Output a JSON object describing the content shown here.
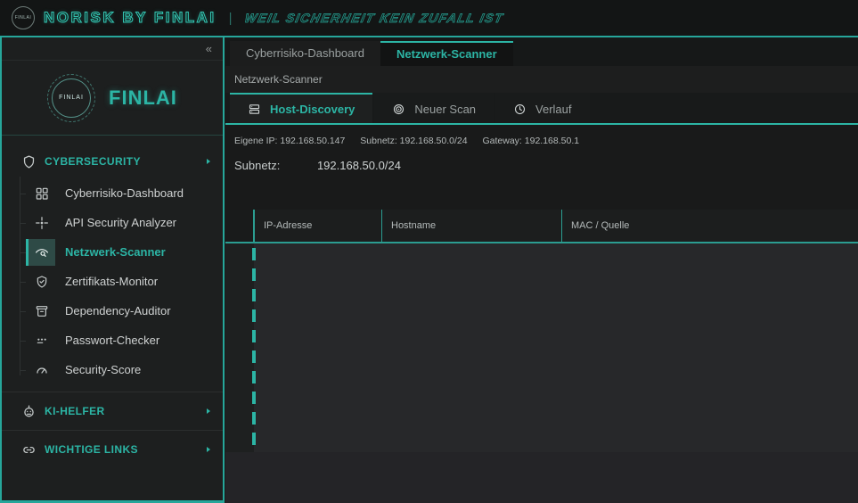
{
  "header": {
    "logo_text": "FINLAI",
    "brand": "NORISK BY FINLAI",
    "separator": "|",
    "tagline": "WEIL SICHERHEIT KEIN ZUFALL IST"
  },
  "sidebar": {
    "collapse_icon": "«",
    "logo": {
      "badge_text": "FINLAI",
      "wordmark": "FINLAI"
    },
    "section_cybersecurity": {
      "label": "CYBERSECURITY"
    },
    "menu": [
      {
        "label": "Cyberrisiko-Dashboard",
        "icon": "dashboard-icon",
        "active": false
      },
      {
        "label": "API Security Analyzer",
        "icon": "crosshair-icon",
        "active": false
      },
      {
        "label": "Netzwerk-Scanner",
        "icon": "network-scan-icon",
        "active": true
      },
      {
        "label": "Zertifikats-Monitor",
        "icon": "shield-check-icon",
        "active": false
      },
      {
        "label": "Dependency-Auditor",
        "icon": "archive-icon",
        "active": false
      },
      {
        "label": "Passwort-Checker",
        "icon": "password-icon",
        "active": false
      },
      {
        "label": "Security-Score",
        "icon": "gauge-icon",
        "active": false
      }
    ],
    "section_ki_helfer": {
      "label": "KI-HELFER"
    },
    "section_wichtige_links": {
      "label": "WICHTIGE LINKS"
    }
  },
  "main": {
    "tabs": [
      {
        "label": "Cyberrisiko-Dashboard",
        "active": false
      },
      {
        "label": "Netzwerk-Scanner",
        "active": true
      }
    ],
    "breadcrumb": "Netzwerk-Scanner",
    "subtabs": [
      {
        "label": "Host-Discovery",
        "icon": "server-icon",
        "active": true
      },
      {
        "label": "Neuer Scan",
        "icon": "radar-icon",
        "active": false
      },
      {
        "label": "Verlauf",
        "icon": "clock-icon",
        "active": false
      }
    ],
    "network_info": {
      "own_ip_label": "Eigene IP:",
      "own_ip": "192.168.50.147",
      "subnet_label": "Subnetz:",
      "subnet": "192.168.50.0/24",
      "gateway_label": "Gateway:",
      "gateway": "192.168.50.1"
    },
    "subnet_field": {
      "label": "Subnetz:",
      "value": "192.168.50.0/24"
    },
    "table": {
      "columns": [
        "IP-Adresse",
        "Hostname",
        "MAC / Quelle"
      ],
      "rows": []
    }
  },
  "colors": {
    "accent": "#2cb5a5",
    "accent_border": "#26a69a"
  }
}
